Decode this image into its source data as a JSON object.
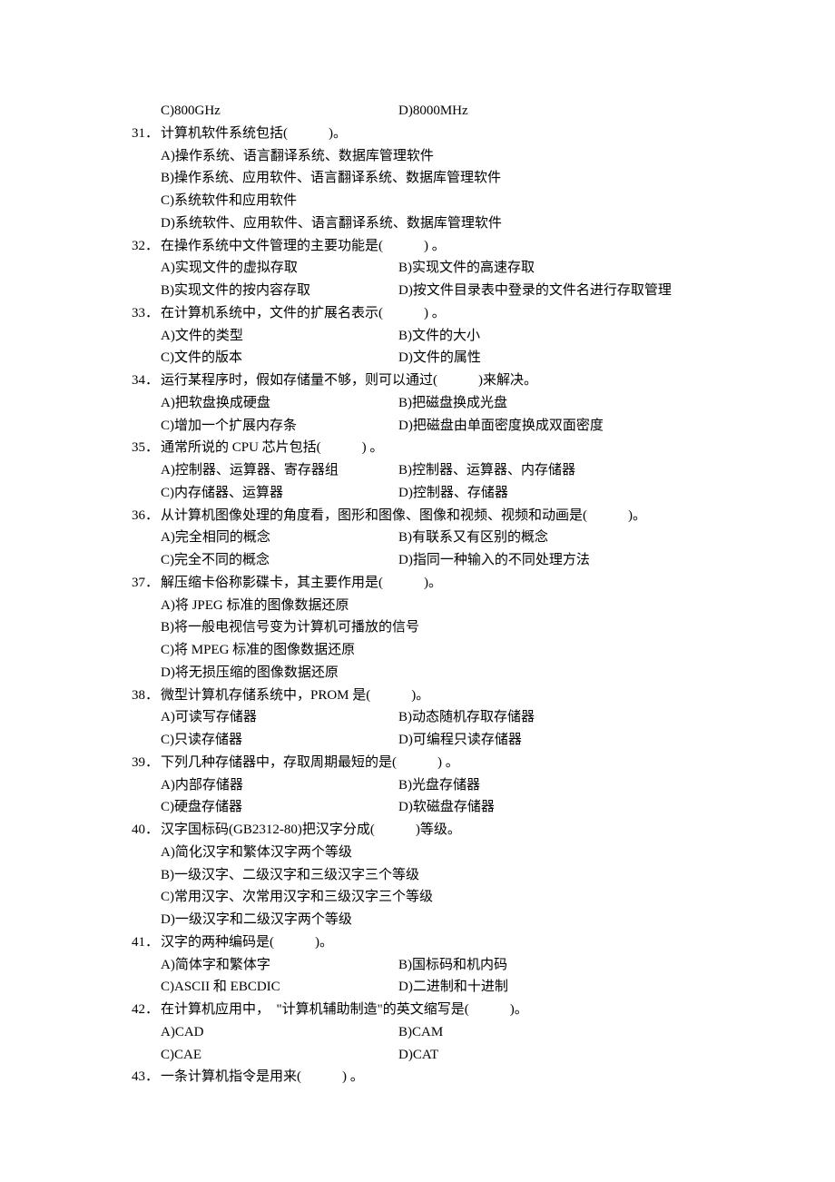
{
  "orphan_options": {
    "c": "C)800GHz",
    "d": "D)8000MHz"
  },
  "questions": [
    {
      "num": "31．",
      "stem": "计算机软件系统包括(　　　)。",
      "layout": "single",
      "opts": [
        "A)操作系统、语言翻译系统、数据库管理软件",
        "B)操作系统、应用软件、语言翻译系统、数据库管理软件",
        "C)系统软件和应用软件",
        "D)系统软件、应用软件、语言翻译系统、数据库管理软件"
      ]
    },
    {
      "num": "32．",
      "stem": "在操作系统中文件管理的主要功能是(　　　) 。",
      "layout": "double",
      "opts": [
        [
          "A)实现文件的虚拟存取",
          "B)实现文件的高速存取"
        ],
        [
          "B)实现文件的按内容存取",
          "D)按文件目录表中登录的文件名进行存取管理"
        ]
      ]
    },
    {
      "num": "33．",
      "stem": "在计算机系统中，文件的扩展名表示(　　　) 。",
      "layout": "double",
      "opts": [
        [
          "A)文件的类型",
          "B)文件的大小"
        ],
        [
          "C)文件的版本",
          "D)文件的属性"
        ]
      ]
    },
    {
      "num": "34．",
      "stem": "运行某程序时，假如存储量不够，则可以通过(　　　)来解决。",
      "layout": "double",
      "opts": [
        [
          "A)把软盘换成硬盘",
          "B)把磁盘换成光盘"
        ],
        [
          "C)增加一个扩展内存条",
          "D)把磁盘由单面密度换成双面密度"
        ]
      ]
    },
    {
      "num": "35．",
      "stem": "通常所说的 CPU 芯片包括(　　　) 。",
      "layout": "double",
      "opts": [
        [
          "A)控制器、运算器、寄存器组",
          "B)控制器、运算器、内存储器"
        ],
        [
          "C)内存储器、运算器",
          "D)控制器、存储器"
        ]
      ]
    },
    {
      "num": "36．",
      "stem": "从计算机图像处理的角度看，图形和图像、图像和视频、视频和动画是(　　　)。",
      "layout": "double",
      "opts": [
        [
          "A)完全相同的概念",
          "B)有联系又有区别的概念"
        ],
        [
          "C)完全不同的概念",
          "D)指同一种输入的不同处理方法"
        ]
      ]
    },
    {
      "num": "37．",
      "stem": "解压缩卡俗称影碟卡，其主要作用是(　　　)。",
      "layout": "single",
      "opts": [
        "A)将 JPEG 标准的图像数据还原",
        "B)将一般电视信号变为计算机可播放的信号",
        "C)将 MPEG 标准的图像数据还原",
        "D)将无损压缩的图像数据还原"
      ]
    },
    {
      "num": "38．",
      "stem": "微型计算机存储系统中，PROM 是(　　　)。",
      "layout": "double",
      "opts": [
        [
          "A)可读写存储器",
          "B)动态随机存取存储器"
        ],
        [
          "C)只读存储器",
          "D)可编程只读存储器"
        ]
      ]
    },
    {
      "num": "39．",
      "stem": "下列几种存储器中，存取周期最短的是(　　　) 。",
      "layout": "double",
      "opts": [
        [
          "A)内部存储器",
          "B)光盘存储器"
        ],
        [
          "C)硬盘存储器",
          "D)软磁盘存储器"
        ]
      ]
    },
    {
      "num": "40．",
      "stem": "汉字国标码(GB2312-80)把汉字分成(　　　)等级。",
      "layout": "single",
      "opts": [
        "A)简化汉字和繁体汉字两个等级",
        "B)一级汉字、二级汉字和三级汉字三个等级",
        "C)常用汉字、次常用汉字和三级汉字三个等级",
        "D)一级汉字和二级汉字两个等级"
      ]
    },
    {
      "num": "41．",
      "stem": "汉字的两种编码是(　　　)。",
      "layout": "double",
      "opts": [
        [
          "A)简体字和繁体字",
          "B)国标码和机内码"
        ],
        [
          "C)ASCII 和 EBCDIC",
          "D)二进制和十进制"
        ]
      ]
    },
    {
      "num": "42．",
      "stem": "在计算机应用中，　\"计算机辅助制造\"的英文缩写是(　　　)。",
      "layout": "double",
      "opts": [
        [
          "A)CAD",
          "B)CAM"
        ],
        [
          "C)CAE",
          "D)CAT"
        ]
      ]
    },
    {
      "num": "43．",
      "stem": "一条计算机指令是用来(　　　) 。",
      "layout": "none",
      "opts": []
    }
  ]
}
